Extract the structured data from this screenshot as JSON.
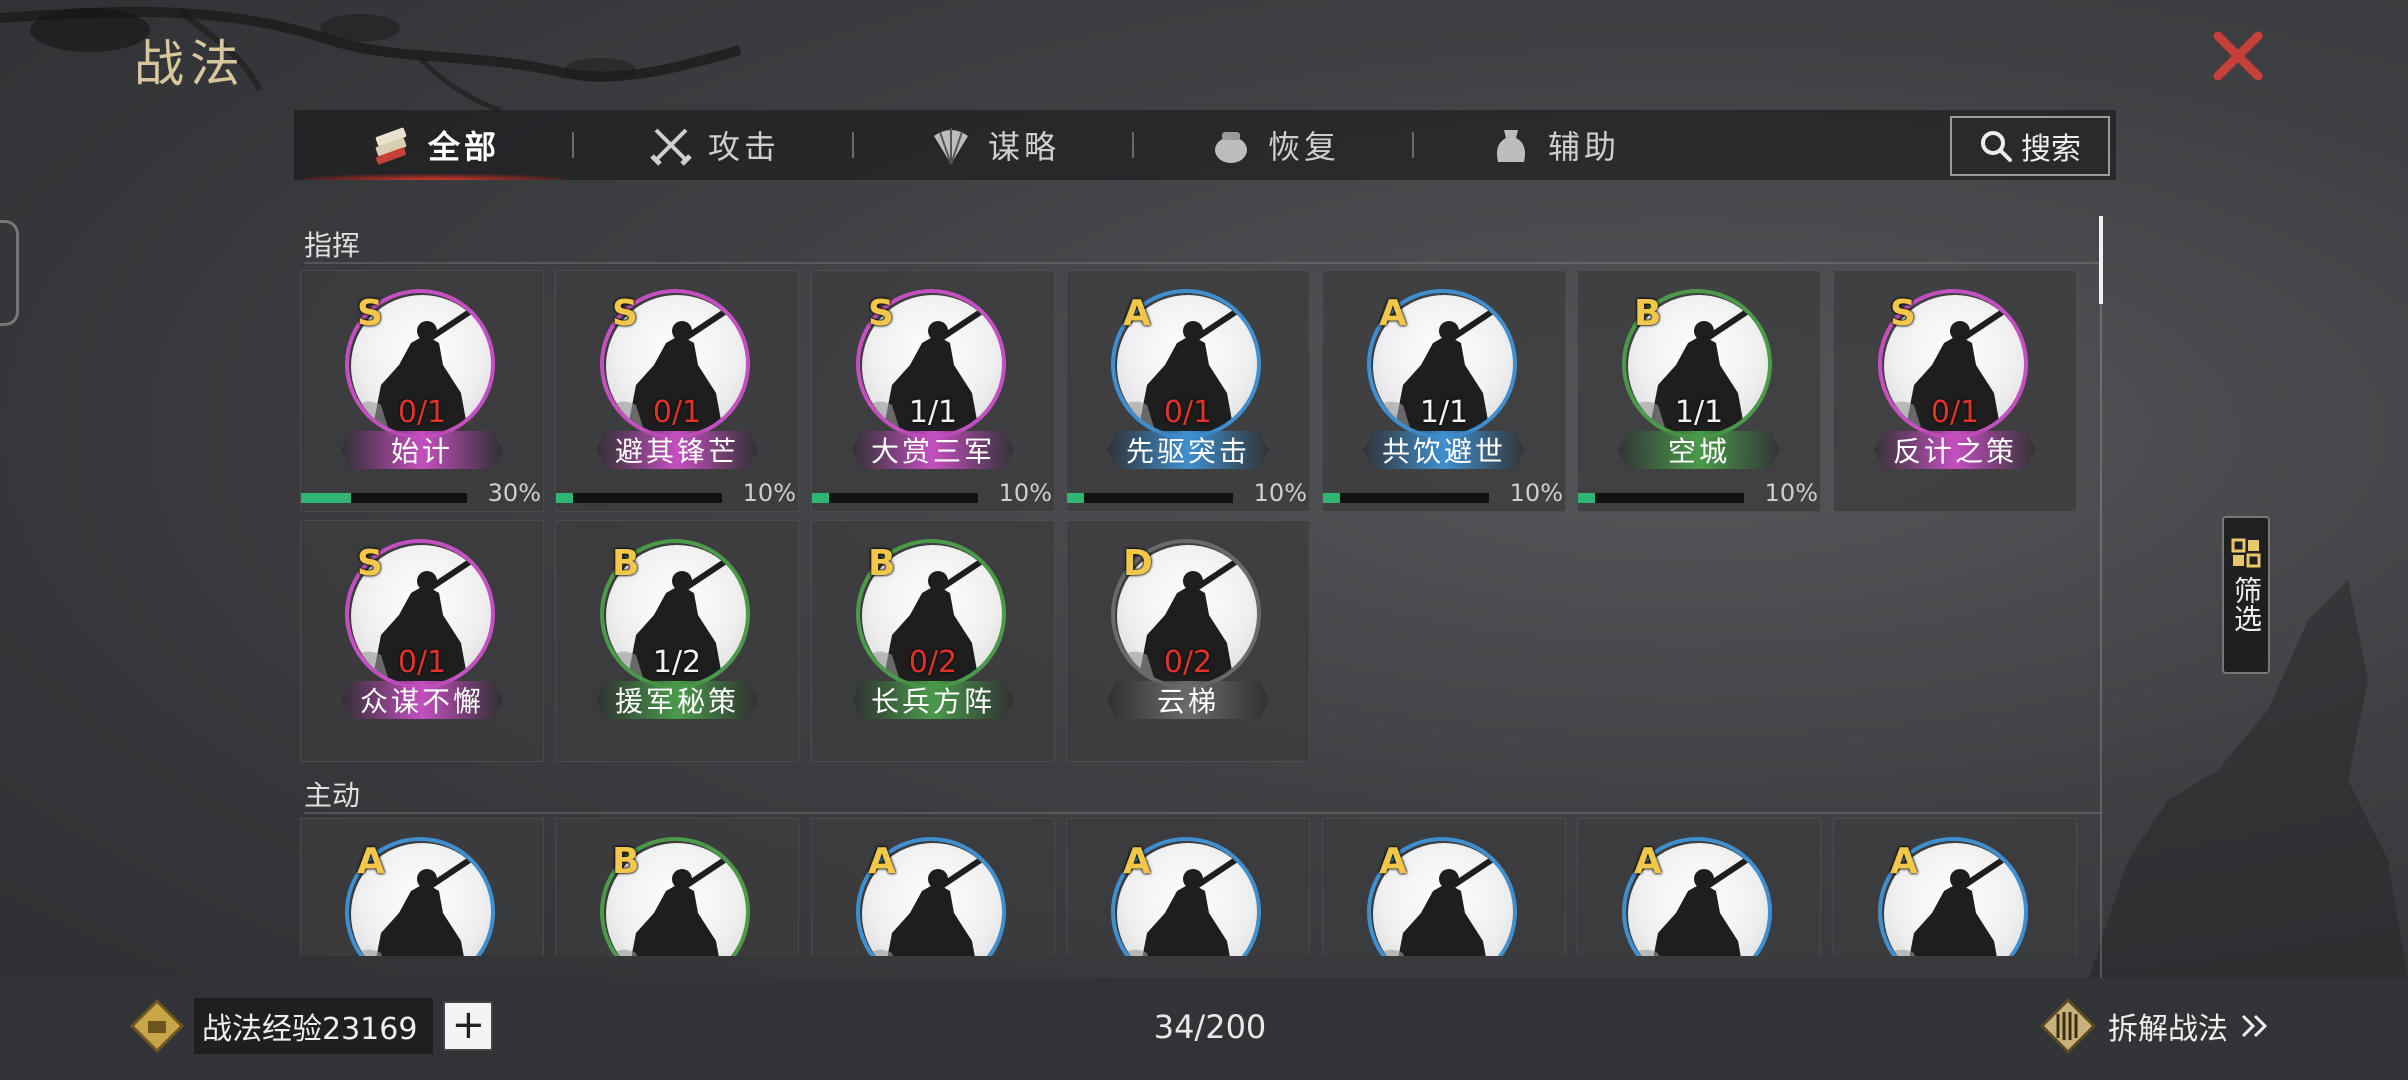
{
  "title": "战法",
  "tabs": [
    {
      "label": "全部",
      "icon": "all-skills-icon",
      "active": true
    },
    {
      "label": "攻击",
      "icon": "crossed-swords-icon",
      "active": false
    },
    {
      "label": "谋略",
      "icon": "strategy-fan-icon",
      "active": false
    },
    {
      "label": "恢复",
      "icon": "recovery-pot-icon",
      "active": false
    },
    {
      "label": "辅助",
      "icon": "support-bag-icon",
      "active": false
    }
  ],
  "search_label": "搜索",
  "filter_label": "筛选",
  "sections": [
    {
      "label": "指挥",
      "cards": [
        {
          "grade": "S",
          "count": "0/1",
          "count_color": "red",
          "name": "始计",
          "tier": "purple",
          "progress": 30,
          "progress_label": "30%"
        },
        {
          "grade": "S",
          "count": "0/1",
          "count_color": "red",
          "name": "避其锋芒",
          "tier": "purple",
          "progress": 10,
          "progress_label": "10%"
        },
        {
          "grade": "S",
          "count": "1/1",
          "count_color": "white",
          "name": "大赏三军",
          "tier": "purple",
          "progress": 10,
          "progress_label": "10%"
        },
        {
          "grade": "A",
          "count": "0/1",
          "count_color": "red",
          "name": "先驱突击",
          "tier": "blue",
          "progress": 10,
          "progress_label": "10%"
        },
        {
          "grade": "A",
          "count": "1/1",
          "count_color": "white",
          "name": "共饮避世",
          "tier": "blue",
          "progress": 10,
          "progress_label": "10%"
        },
        {
          "grade": "B",
          "count": "1/1",
          "count_color": "white",
          "name": "空城",
          "tier": "green",
          "progress": 10,
          "progress_label": "10%"
        },
        {
          "grade": "S",
          "count": "0/1",
          "count_color": "red",
          "name": "反计之策",
          "tier": "purple",
          "progress": null,
          "progress_label": ""
        },
        {
          "grade": "S",
          "count": "0/1",
          "count_color": "red",
          "name": "众谋不懈",
          "tier": "purple",
          "progress": null,
          "progress_label": ""
        },
        {
          "grade": "B",
          "count": "1/2",
          "count_color": "white",
          "name": "援军秘策",
          "tier": "green",
          "progress": null,
          "progress_label": ""
        },
        {
          "grade": "B",
          "count": "0/2",
          "count_color": "red",
          "name": "长兵方阵",
          "tier": "green",
          "progress": null,
          "progress_label": ""
        },
        {
          "grade": "D",
          "count": "0/2",
          "count_color": "red",
          "name": "云梯",
          "tier": "gray",
          "progress": null,
          "progress_label": ""
        }
      ]
    },
    {
      "label": "主动",
      "cards": [
        {
          "grade": "A",
          "tier": "blue"
        },
        {
          "grade": "B",
          "tier": "green"
        },
        {
          "grade": "A",
          "tier": "blue"
        },
        {
          "grade": "A",
          "tier": "blue"
        },
        {
          "grade": "A",
          "tier": "blue"
        },
        {
          "grade": "A",
          "tier": "blue"
        },
        {
          "grade": "A",
          "tier": "blue"
        }
      ]
    }
  ],
  "tier_colors": {
    "purple": "#c44fc0",
    "blue": "#3f8fd0",
    "green": "#4a9a4a",
    "gray": "#6a6a6a"
  },
  "bottom": {
    "exp_label": "战法经验23169",
    "plus_label": "+",
    "total_count": "34/200",
    "disassemble_label": "拆解战法"
  }
}
